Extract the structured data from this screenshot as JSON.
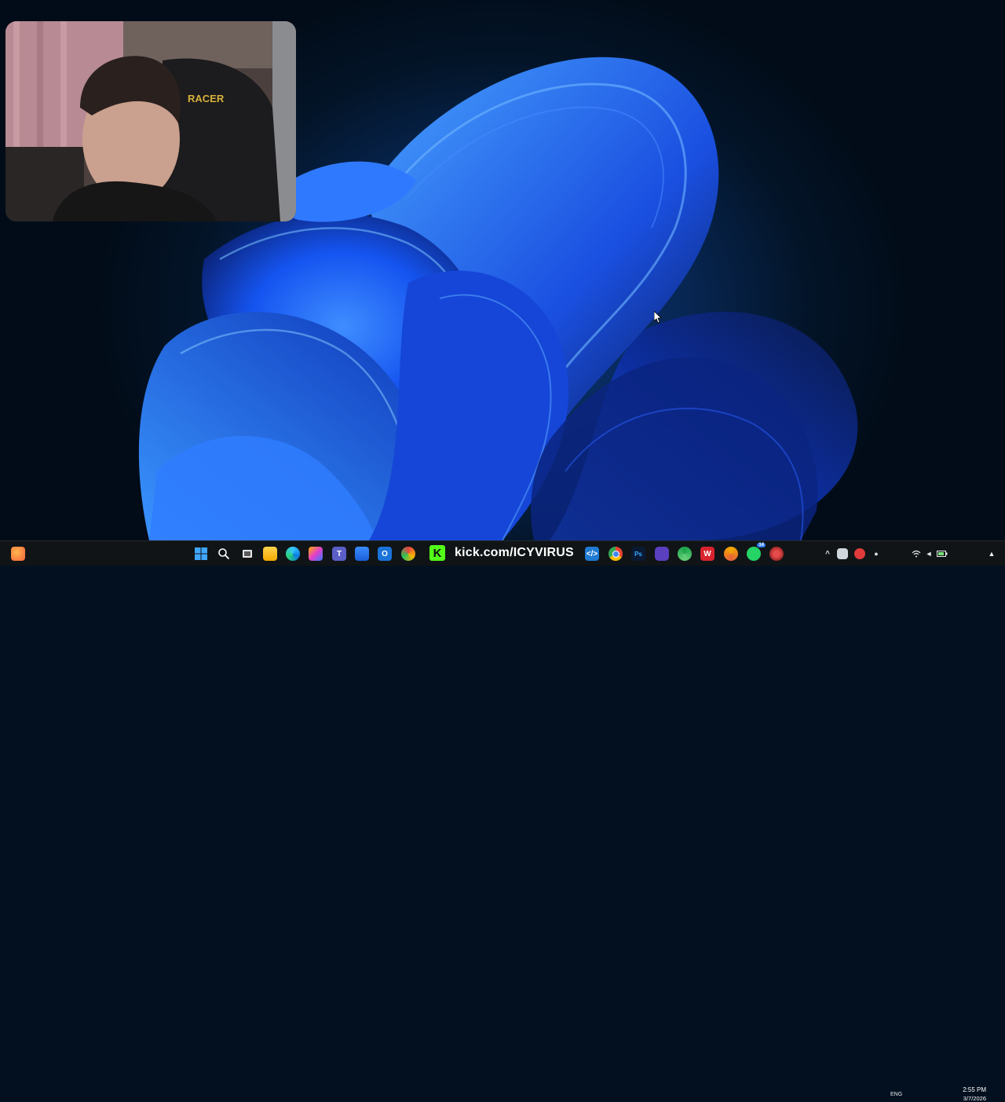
{
  "desktop": {
    "wallpaper": "windows-11-bloom",
    "colors": {
      "accent": "#1f6cff",
      "deep": "#0a2f9e",
      "background": "#03101f"
    }
  },
  "webcam_overlay": {
    "visible": true,
    "chair_brand_text": "RACER"
  },
  "stream_banner": {
    "text": "kick.com/ICYVIRUS",
    "logo_letter": "K",
    "brand_color": "#53fc18"
  },
  "taskbar": {
    "left_widget_icon": "weather-widget-icon",
    "pinned_icons": [
      "start-icon",
      "search-icon",
      "task-view-icon",
      "file-explorer-icon",
      "edge-icon",
      "copilot-icon",
      "teams-icon",
      "store-icon",
      "outlook-icon",
      "app-icon",
      "vscode-icon",
      "chrome-icon",
      "photoshop-icon",
      "obs-icon",
      "phone-link-icon",
      "wps-icon",
      "chrome-canary-icon",
      "whatsapp-icon",
      "settings-icon"
    ],
    "whatsapp_badge": "14",
    "tray": {
      "language": "ENG",
      "time": "2:55 PM",
      "date": "3/7/2026"
    }
  }
}
